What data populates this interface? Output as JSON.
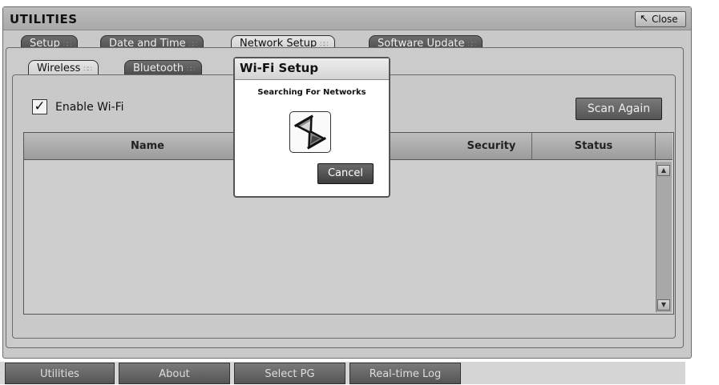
{
  "window": {
    "title": "UTILITIES",
    "close_label": "Close"
  },
  "tabs": [
    {
      "label": "Setup",
      "active": false
    },
    {
      "label": "Date and Time",
      "active": false
    },
    {
      "label": "Network Setup",
      "active": true
    },
    {
      "label": "Software Update",
      "active": false
    }
  ],
  "subtabs": [
    {
      "label": "Wireless",
      "active": true
    },
    {
      "label": "Bluetooth",
      "active": false
    }
  ],
  "wifi": {
    "enable_label": "Enable Wi-Fi",
    "enabled": true,
    "scan_again_label": "Scan Again"
  },
  "table": {
    "columns": [
      "Name",
      "Security",
      "Status"
    ],
    "rows": []
  },
  "dialog": {
    "title": "Wi-Fi Setup",
    "message": "Searching For Networks",
    "icon": "hourglass-icon",
    "cancel_label": "Cancel"
  },
  "bottom_nav": [
    {
      "label": "Utilities"
    },
    {
      "label": "About"
    },
    {
      "label": "Select PG"
    },
    {
      "label": "Real-time Log"
    }
  ]
}
